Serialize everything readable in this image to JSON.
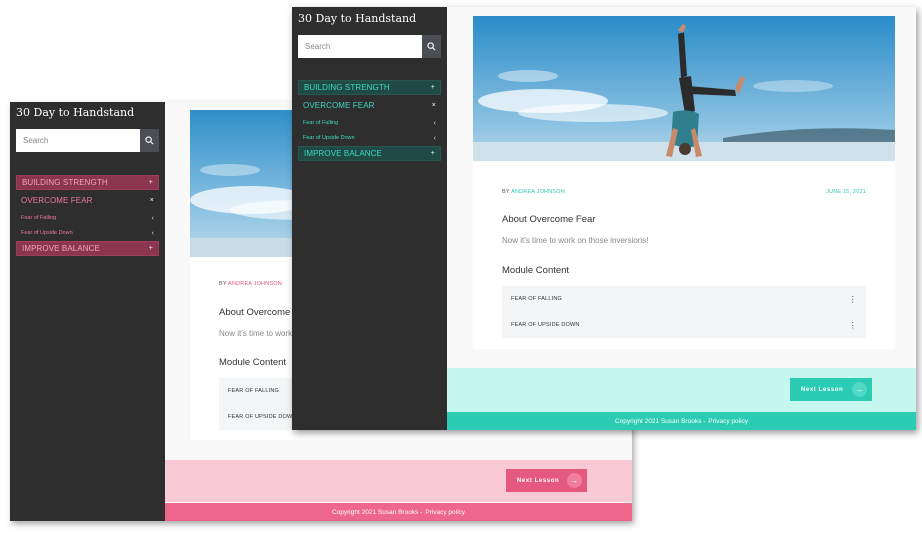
{
  "site_title": "30 Day to Handstand",
  "search": {
    "placeholder": "Search"
  },
  "menu": {
    "building_strength": "BUILDING STRENGTH",
    "overcome_fear": "OVERCOME FEAR",
    "fear_of_falling": "Fear of Falling",
    "fear_of_upside_down": "Fear of Upside Down",
    "improve_balance": "IMPROVE BALANCE",
    "plus_symbol": "+",
    "close_symbol": "×",
    "chevron_symbol": "‹"
  },
  "dots_label": "···",
  "post": {
    "by_prefix": "BY",
    "author": "ANDREA JOHNSON",
    "date": "JUNE 15, 2021",
    "about_title": "About Overcome Fear",
    "about_text": "Now it's time to work on those inversions!",
    "module_title": "Module Content",
    "lessons": [
      "FEAR OF FALLING",
      "FEAR OF UPSIDE DOWN"
    ],
    "kebab": "⋮"
  },
  "next_lesson": {
    "label": "Next Lesson",
    "arrow": "→"
  },
  "footer": {
    "copyright": "Copyright 2021 Susan Brooks -",
    "privacy": "Privacy policy"
  },
  "themes": {
    "pink": "#ee6689",
    "teal": "#2ccbb4"
  },
  "icons": {
    "search": "search-icon",
    "arrow": "arrow-right-icon",
    "dots": "more-icon",
    "kebab": "kebab-icon"
  }
}
